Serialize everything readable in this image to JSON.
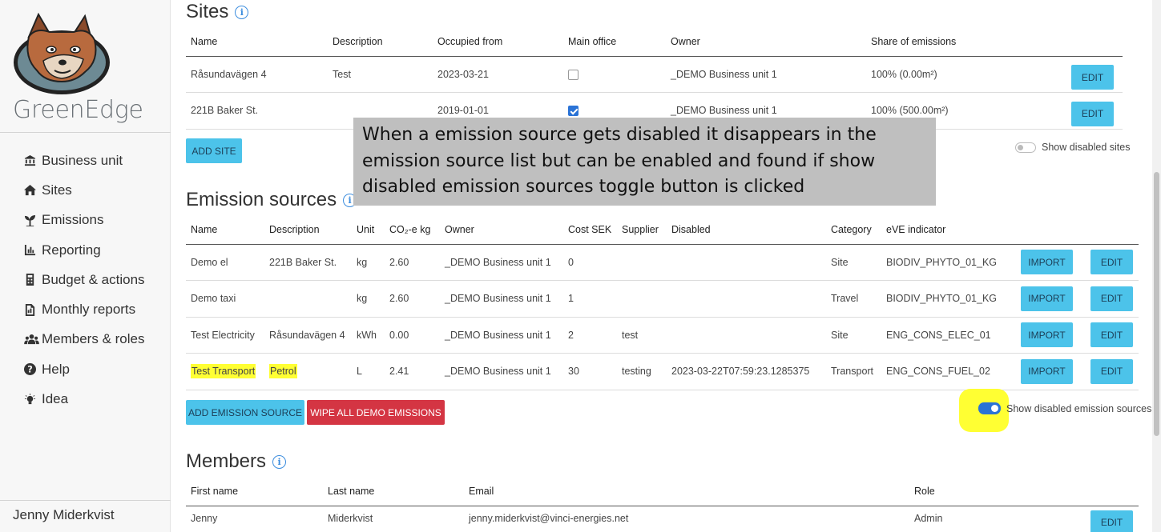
{
  "sidebar": {
    "brand": "GreenEdge",
    "items": [
      {
        "label": "Business unit",
        "icon": "bank-icon"
      },
      {
        "label": "Sites",
        "icon": "home-icon"
      },
      {
        "label": "Emissions",
        "icon": "plant-icon"
      },
      {
        "label": "Reporting",
        "icon": "bar-chart-icon"
      },
      {
        "label": "Budget & actions",
        "icon": "calculator-icon"
      },
      {
        "label": "Monthly reports",
        "icon": "file-report-icon"
      },
      {
        "label": "Members & roles",
        "icon": "users-icon"
      },
      {
        "label": "Help",
        "icon": "question-circle-icon"
      },
      {
        "label": "Idea",
        "icon": "lightbulb-icon"
      }
    ],
    "user": "Jenny Miderkvist"
  },
  "sites": {
    "title": "Sites",
    "columns": [
      "Name",
      "Description",
      "Occupied from",
      "Main office",
      "Owner",
      "Share of emissions"
    ],
    "rows": [
      {
        "name": "Råsundavägen 4",
        "description": "Test",
        "occupied": "2023-03-21",
        "main_office": false,
        "owner": "_DEMO Business unit 1",
        "share": "100% (0.00m²)",
        "edit": "EDIT"
      },
      {
        "name": "221B Baker St.",
        "description": "",
        "occupied": "2019-01-01",
        "main_office": true,
        "owner": "_DEMO Business unit 1",
        "share": "100% (500.00m²)",
        "edit": "EDIT"
      }
    ],
    "add_label": "ADD SITE",
    "toggle_label": "Show disabled sites"
  },
  "emission_sources": {
    "title": "Emission sources",
    "columns": [
      "Name",
      "Description",
      "Unit",
      "CO₂-e kg",
      "Owner",
      "Cost SEK",
      "Supplier",
      "Disabled",
      "Category",
      "eVE indicator"
    ],
    "rows": [
      {
        "name": "Demo el",
        "description": "221B Baker St.",
        "unit": "kg",
        "co2": "2.60",
        "owner": "_DEMO Business unit 1",
        "cost": "0",
        "supplier": "",
        "disabled": "",
        "category": "Site",
        "indicator": "BIODIV_PHYTO_01_KG",
        "import": "IMPORT",
        "edit": "EDIT"
      },
      {
        "name": "Demo taxi",
        "description": "",
        "unit": "kg",
        "co2": "2.60",
        "owner": "_DEMO Business unit 1",
        "cost": "1",
        "supplier": "",
        "disabled": "",
        "category": "Travel",
        "indicator": "BIODIV_PHYTO_01_KG",
        "import": "IMPORT",
        "edit": "EDIT"
      },
      {
        "name": "Test Electricity",
        "description": "Råsundavägen 4",
        "unit": "kWh",
        "co2": "0.00",
        "owner": "_DEMO Business unit 1",
        "cost": "2",
        "supplier": "test",
        "disabled": "",
        "category": "Site",
        "indicator": "ENG_CONS_ELEC_01",
        "import": "IMPORT",
        "edit": "EDIT"
      },
      {
        "name": "Test Transport",
        "description": "Petrol",
        "unit": "L",
        "co2": "2.41",
        "owner": "_DEMO Business unit 1",
        "cost": "30",
        "supplier": "testing",
        "disabled": "2023-03-22T07:59:23.1285375",
        "category": "Transport",
        "indicator": "ENG_CONS_FUEL_02",
        "import": "IMPORT",
        "edit": "EDIT"
      }
    ],
    "add_label": "ADD EMISSION SOURCE",
    "wipe_label": "WIPE ALL DEMO EMISSIONS",
    "toggle_label": "Show disabled emission sources",
    "toggle_on": true
  },
  "members": {
    "title": "Members",
    "columns": [
      "First name",
      "Last name",
      "Email",
      "Role"
    ],
    "rows": [
      {
        "first": "Jenny",
        "last": "Miderkvist",
        "email": "jenny.miderkvist@vinci-energies.net",
        "role": "Admin",
        "edit": "EDIT"
      }
    ]
  },
  "annotation": {
    "text": "When a emission source gets disabled it disappears in the emission source list but can be enabled and found if show disabled emission sources toggle button is clicked",
    "highlight_color": "#ffff33"
  },
  "colors": {
    "accent": "#4cc3ea",
    "danger": "#d43543",
    "toggle": "#2a73d6"
  }
}
